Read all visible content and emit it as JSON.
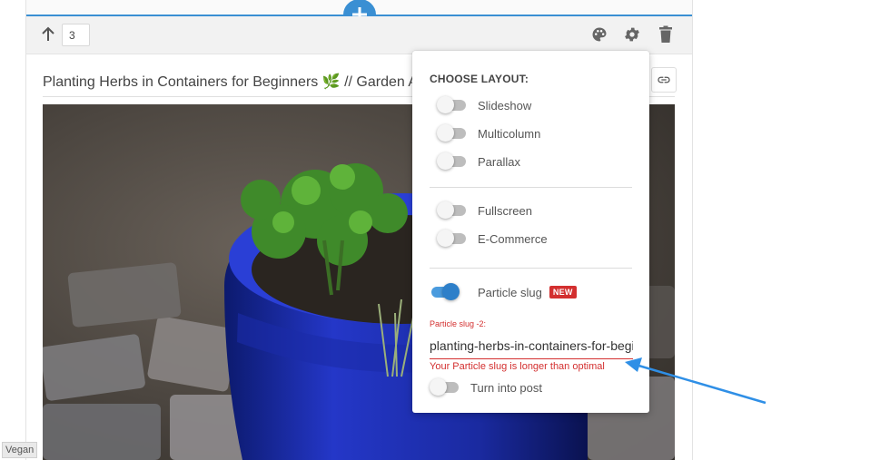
{
  "toolbar": {
    "position_value": "3"
  },
  "post": {
    "title": "Planting Herbs in Containers for Beginners 🌿 // Garden Answer"
  },
  "sidebar_label": "Vegan",
  "layout_menu": {
    "heading": "CHOOSE LAYOUT:",
    "options": [
      {
        "label": "Slideshow",
        "on": false
      },
      {
        "label": "Multicolumn",
        "on": false
      },
      {
        "label": "Parallax",
        "on": false
      },
      {
        "label": "Fullscreen",
        "on": false
      },
      {
        "label": "E-Commerce",
        "on": false
      }
    ],
    "particle_slug": {
      "label": "Particle slug",
      "on": true,
      "badge": "NEW",
      "caption": "Particle slug -2:",
      "value": "planting-herbs-in-containers-for-beginners-garden-answer",
      "error": "Your Particle slug is longer than optimal"
    },
    "turn_into_post": {
      "label": "Turn into post",
      "on": false
    }
  },
  "colors": {
    "accent": "#3a8fd3",
    "error": "#d32f2f",
    "arrow": "#2f8fe6"
  }
}
